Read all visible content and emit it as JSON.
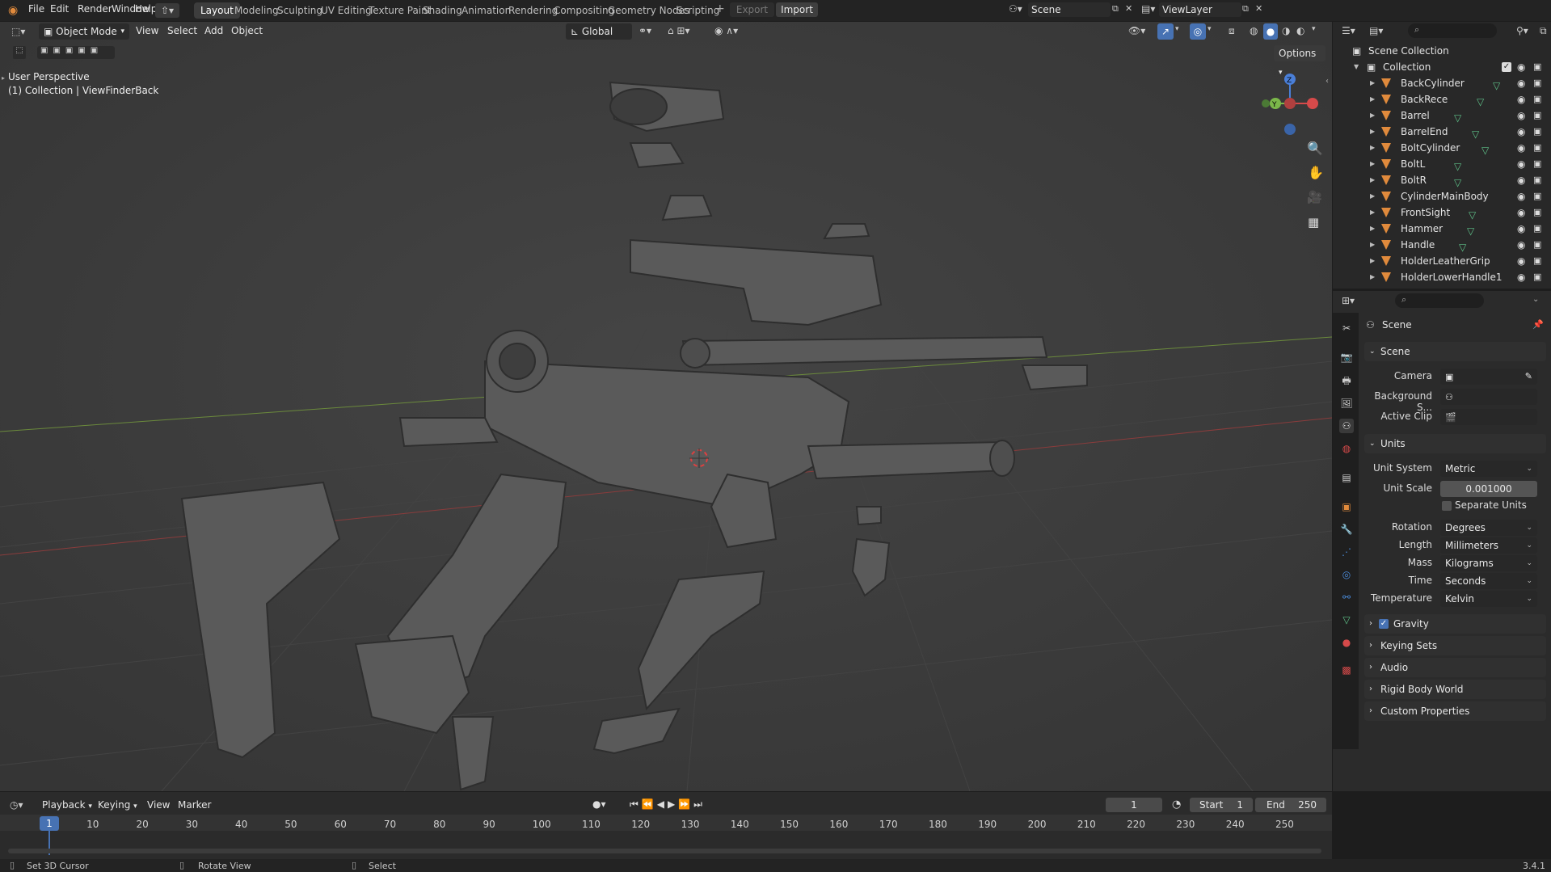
{
  "topbar": {
    "menus": [
      "File",
      "Edit",
      "Render",
      "Window",
      "Help"
    ],
    "workspaces": [
      "Layout",
      "Modeling",
      "Sculpting",
      "UV Editing",
      "Texture Paint",
      "Shading",
      "Animation",
      "Rendering",
      "Compositing",
      "Geometry Nodes",
      "Scripting"
    ],
    "active_workspace": "Layout",
    "export_label": "Export",
    "import_label": "Import",
    "scene_name": "Scene",
    "view_layer": "ViewLayer"
  },
  "viewport": {
    "mode": "Object Mode",
    "menus": [
      "View",
      "Select",
      "Add",
      "Object"
    ],
    "transform_orientation": "Global",
    "options_label": "Options",
    "overlay_text_1": "User Perspective",
    "overlay_text_2": "(1) Collection | ViewFinderBack"
  },
  "outliner": {
    "root": "Scene Collection",
    "collection": "Collection",
    "items": [
      "BackCylinder",
      "BackRece",
      "Barrel",
      "BarrelEnd",
      "BoltCylinder",
      "BoltL",
      "BoltR",
      "CylinderMainBody",
      "FrontSight",
      "Hammer",
      "Handle",
      "HolderLeatherGrip",
      "HolderLowerHandle1"
    ]
  },
  "properties": {
    "header": "Scene",
    "scene_panel": "Scene",
    "camera_label": "Camera",
    "background_label": "Background S...",
    "active_clip_label": "Active Clip",
    "units_panel": "Units",
    "unit_system_label": "Unit System",
    "unit_system": "Metric",
    "unit_scale_label": "Unit Scale",
    "unit_scale": "0.001000",
    "separate_units": "Separate Units",
    "rotation_label": "Rotation",
    "rotation": "Degrees",
    "length_label": "Length",
    "length": "Millimeters",
    "mass_label": "Mass",
    "mass": "Kilograms",
    "time_label": "Time",
    "time": "Seconds",
    "temperature_label": "Temperature",
    "temperature": "Kelvin",
    "collapsed_panels": [
      "Gravity",
      "Keying Sets",
      "Audio",
      "Rigid Body World",
      "Custom Properties"
    ]
  },
  "timeline": {
    "menus": [
      "Playback",
      "Keying",
      "View",
      "Marker"
    ],
    "current_frame": "1",
    "start_label": "Start",
    "start": "1",
    "end_label": "End",
    "end": "250",
    "frame_ticks": [
      "1",
      "10",
      "20",
      "30",
      "40",
      "50",
      "60",
      "70",
      "80",
      "90",
      "100",
      "110",
      "120",
      "130",
      "140",
      "150",
      "160",
      "170",
      "180",
      "190",
      "200",
      "210",
      "220",
      "230",
      "240",
      "250"
    ]
  },
  "status": {
    "hint1": "Set 3D Cursor",
    "hint2": "Rotate View",
    "hint3": "Select",
    "version": "3.4.1"
  },
  "colors": {
    "accent": "#4772b3",
    "object_orange": "#e08a3c",
    "mesh_green": "#5fc289",
    "viewport_bg": "#3a3a3a"
  }
}
